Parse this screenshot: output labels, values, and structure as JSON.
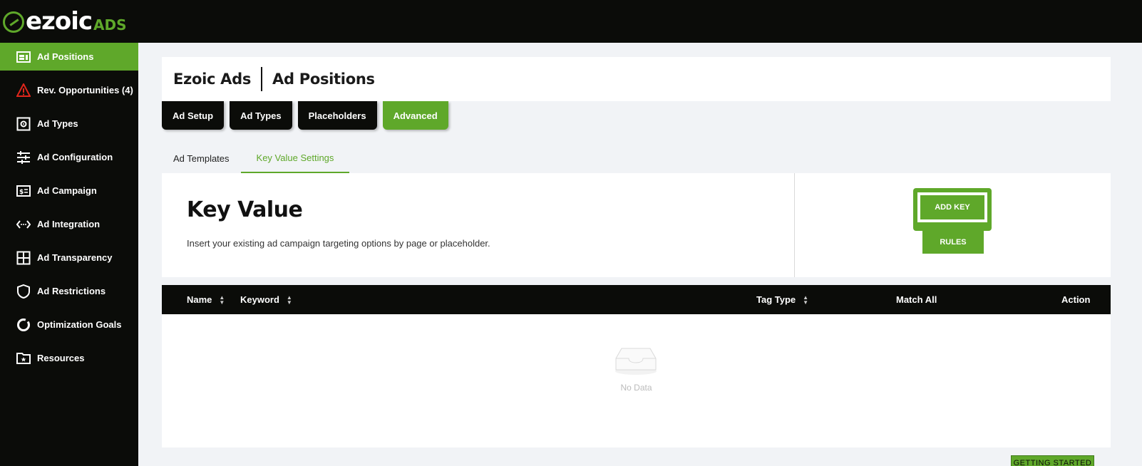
{
  "brand": {
    "word": "ezoic",
    "sub": "ADS",
    "accent": "#5fa82a"
  },
  "sidebar": {
    "items": [
      {
        "label": "Ad Positions",
        "icon": "ad-positions-icon",
        "active": true
      },
      {
        "label": "Rev. Opportunities (4)",
        "icon": "warning-icon"
      },
      {
        "label": "Ad Types",
        "icon": "gear-box-icon"
      },
      {
        "label": "Ad Configuration",
        "icon": "sliders-icon"
      },
      {
        "label": "Ad Campaign",
        "icon": "campaign-icon"
      },
      {
        "label": "Ad Integration",
        "icon": "integration-icon"
      },
      {
        "label": "Ad Transparency",
        "icon": "grid-icon"
      },
      {
        "label": "Ad Restrictions",
        "icon": "shield-icon"
      },
      {
        "label": "Optimization Goals",
        "icon": "donut-icon"
      },
      {
        "label": "Resources",
        "icon": "folder-star-icon"
      }
    ]
  },
  "header": {
    "crumb1": "Ezoic Ads",
    "crumb2": "Ad Positions"
  },
  "tabs": [
    "Ad Setup",
    "Ad Types",
    "Placeholders",
    "Advanced"
  ],
  "sub_tabs": [
    "Ad Templates",
    "Key Value Settings"
  ],
  "key_value": {
    "title": "Key Value",
    "description": "Insert your existing ad campaign targeting options by page or placeholder.",
    "add_key_label": "ADD KEY",
    "rules_label": "RULES"
  },
  "table": {
    "columns": [
      "Name",
      "Keyword",
      "Tag Type",
      "Match All",
      "Action"
    ],
    "empty_text": "No Data"
  },
  "getting_started_label": "GETTING STARTED"
}
